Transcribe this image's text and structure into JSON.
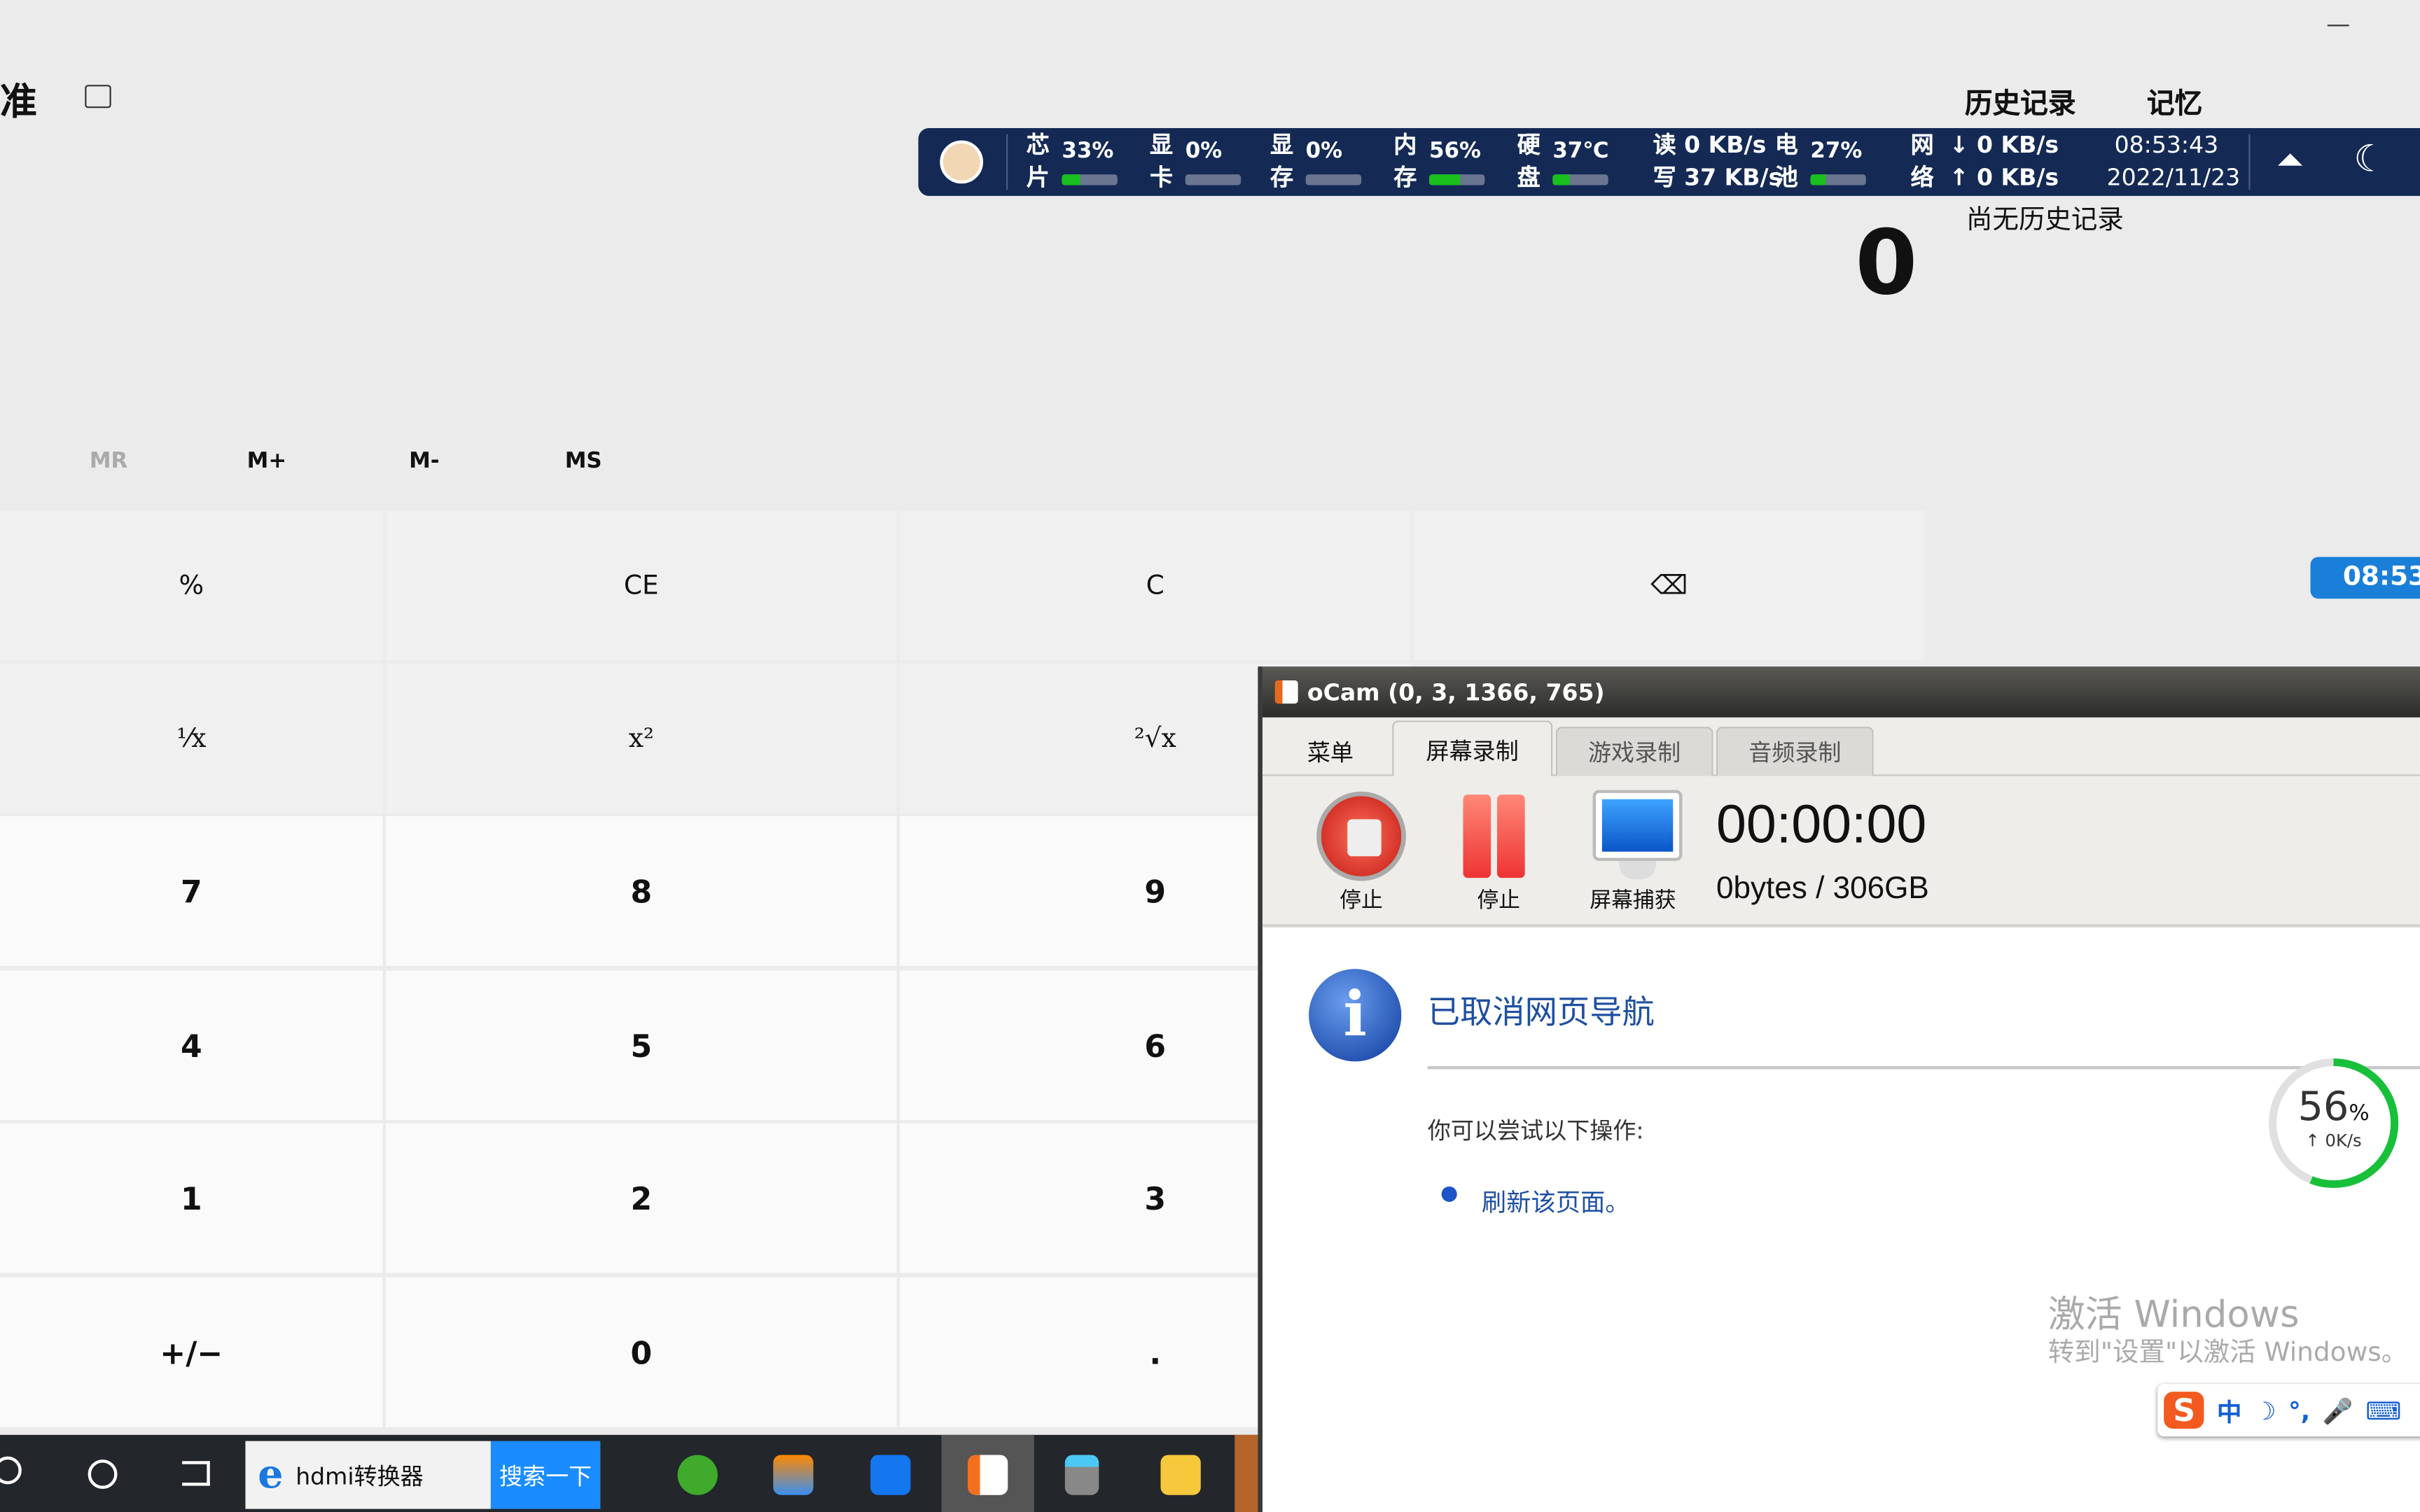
{
  "calculator": {
    "mode_title": "准",
    "keep_on_top_icon": "compact-overlay-icon",
    "history_tab": "历史记录",
    "memory_tab": "记忆",
    "no_history": "尚无历史记录",
    "display": "0",
    "memory": [
      "MR",
      "M+",
      "M-",
      "MS"
    ],
    "keys": [
      [
        "%",
        "CE",
        "C",
        "⌫"
      ],
      [
        "¹⁄x",
        "x²",
        "²√x"
      ],
      [
        "7",
        "8",
        "9"
      ],
      [
        "4",
        "5",
        "6"
      ],
      [
        "1",
        "2",
        "3"
      ],
      [
        "+/−",
        "0",
        "."
      ]
    ]
  },
  "status_bar": {
    "cpu": {
      "label": [
        "芯",
        "片"
      ],
      "value": "33%",
      "level": 33
    },
    "gpu": {
      "label": [
        "显",
        "卡"
      ],
      "value": "0%",
      "level": 0
    },
    "vram": {
      "label": [
        "显",
        "存"
      ],
      "value": "0%",
      "level": 0
    },
    "mem": {
      "label": [
        "内",
        "存"
      ],
      "value": "56%",
      "level": 56
    },
    "disk": {
      "label": [
        "硬",
        "盘"
      ],
      "value": "37℃",
      "level": 30,
      "read": "读 0 KB/s",
      "write": "写 37 KB/s"
    },
    "battery": {
      "label": [
        "电",
        "池"
      ],
      "value": "27%",
      "level": 27
    },
    "net": {
      "label": [
        "网",
        "络"
      ],
      "down": "↓ 0 KB/s",
      "up": "↑ 0 KB/s"
    },
    "time": "08:53:43",
    "date": "2022/11/23",
    "colors": {
      "bg": "#142a55",
      "fill": "#19c01e"
    }
  },
  "clock_badge": "08:53",
  "ocam": {
    "title": "oCam (0, 3, 1366, 765)",
    "tabs": [
      "菜单",
      "屏幕录制",
      "游戏录制",
      "音频录制"
    ],
    "active_tab": "屏幕录制",
    "tools": [
      "停止",
      "停止",
      "屏幕捕获"
    ],
    "timer": "00:00:00",
    "size": "0bytes / 306GB"
  },
  "browser_error": {
    "heading": "已取消网页导航",
    "hint": "你可以尝试以下操作:",
    "link": "刷新该页面。"
  },
  "gauge": {
    "value": "56",
    "unit": "%",
    "speed": "↑ 0K/s",
    "level": 56
  },
  "watermark": {
    "line1": "激活 Windows",
    "line2": "转到\"设置\"以激活 Windows。"
  },
  "ime": {
    "items": [
      "中",
      "☽",
      "°,",
      "🎤",
      "⌨"
    ]
  },
  "taskbar": {
    "search_text": "hdmi转换器",
    "search_button": "搜索一下"
  }
}
